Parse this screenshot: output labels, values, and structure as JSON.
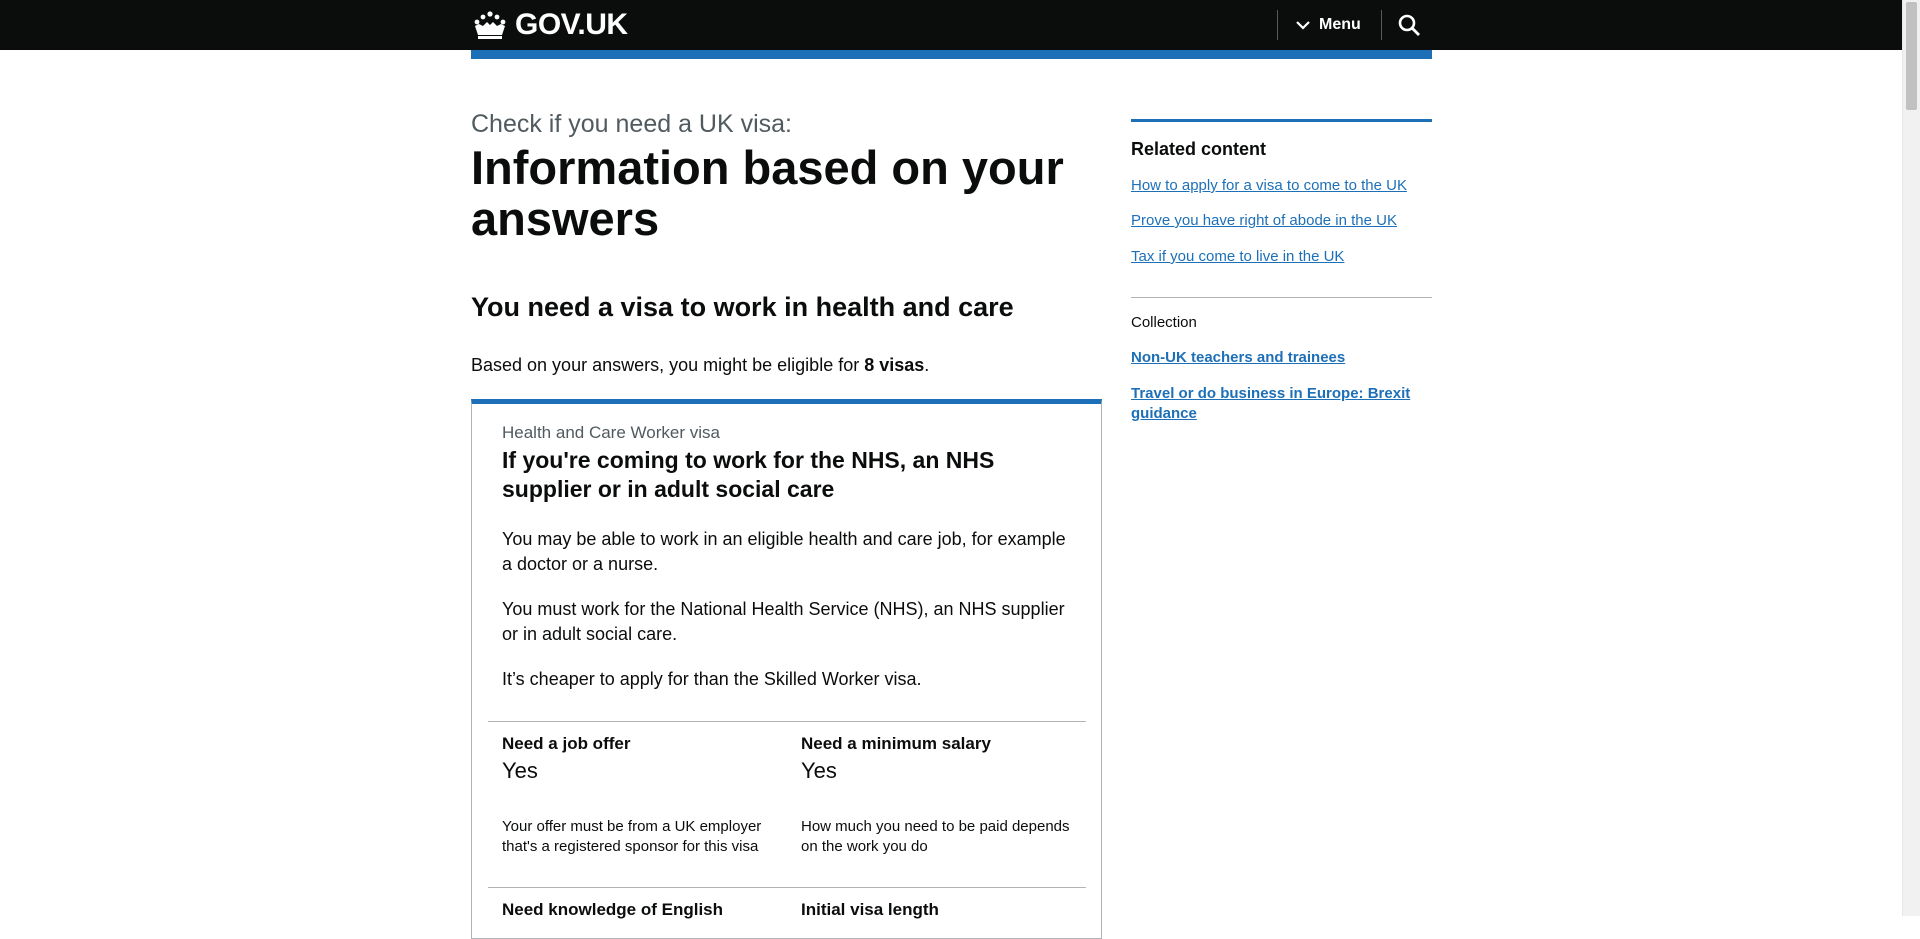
{
  "header": {
    "logo_text": "GOV.UK",
    "menu_label": "Menu",
    "accent_color": "#1d70b8"
  },
  "main": {
    "caption": "Check if you need a UK visa:",
    "title": "Information based on your answers",
    "subtitle": "You need a visa to work in health and care",
    "eligible_prefix": "Based on your answers, you might be eligible for ",
    "eligible_count": "8 visas",
    "eligible_suffix": ".",
    "card": {
      "caption": "Health and Care Worker visa",
      "title": "If you're coming to work for the NHS, an NHS supplier or in adult social care",
      "paragraphs": [
        "You may be able to work in an eligible health and care job, for example a doctor or a nurse.",
        "You must work for the National Health Service (NHS), an NHS supplier or in adult social care.",
        "It’s cheaper to apply for than the Skilled Worker visa."
      ],
      "attributes": [
        {
          "label": "Need a job offer",
          "value": "Yes",
          "description": "Your offer must be from a UK employer that's a registered sponsor for this visa"
        },
        {
          "label": "Need a minimum salary",
          "value": "Yes",
          "description": "How much you need to be paid depends on the work you do"
        },
        {
          "label": "Need knowledge of English"
        },
        {
          "label": "Initial visa length"
        }
      ]
    }
  },
  "sidebar": {
    "heading": "Related content",
    "links": [
      "How to apply for a visa to come to the UK",
      "Prove you have right of abode in the UK",
      "Tax if you come to live in the UK"
    ],
    "collection_label": "Collection",
    "collection_links": [
      "Non-UK teachers and trainees",
      "Travel or do business in Europe: Brexit guidance"
    ]
  }
}
